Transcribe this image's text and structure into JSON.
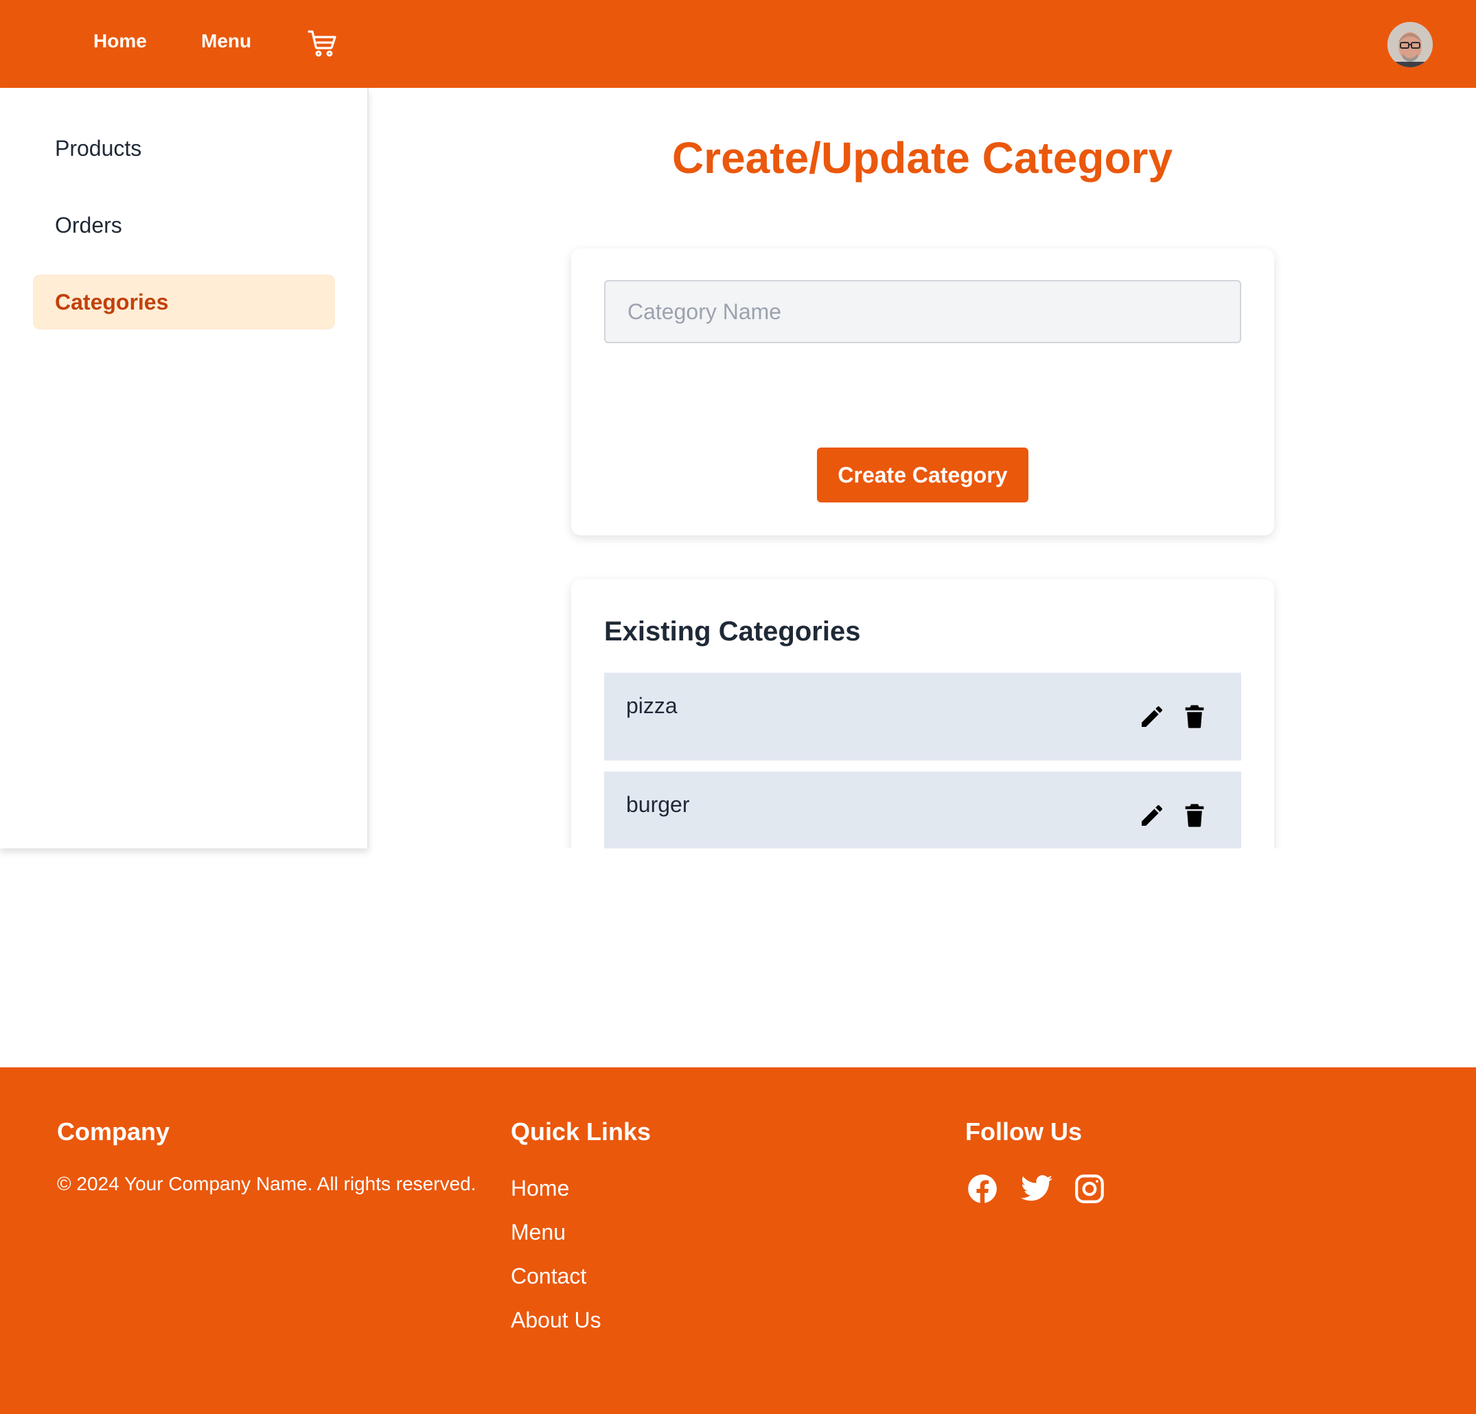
{
  "header": {
    "nav": [
      {
        "label": "Home"
      },
      {
        "label": "Menu"
      }
    ],
    "cart_icon": "shopping-cart-icon",
    "avatar": "user-avatar"
  },
  "sidebar": {
    "items": [
      {
        "label": "Products",
        "active": false
      },
      {
        "label": "Orders",
        "active": false
      },
      {
        "label": "Categories",
        "active": true
      }
    ]
  },
  "main": {
    "title": "Create/Update Category",
    "form": {
      "category_name": {
        "value": "",
        "placeholder": "Category Name"
      },
      "submit_label": "Create Category"
    },
    "list": {
      "heading": "Existing Categories",
      "items": [
        {
          "name": "pizza",
          "actions": [
            "pencil-icon",
            "trash-icon"
          ]
        },
        {
          "name": "burger",
          "actions": [
            "pencil-icon",
            "trash-icon"
          ]
        }
      ]
    }
  },
  "footer": {
    "company": {
      "heading": "Company",
      "copyright": "© 2024 Your Company Name. All rights reserved."
    },
    "quick_links": {
      "heading": "Quick Links",
      "links": [
        {
          "label": "Home"
        },
        {
          "label": "Menu"
        },
        {
          "label": "Contact"
        },
        {
          "label": "About Us"
        }
      ]
    },
    "follow": {
      "heading": "Follow Us",
      "icons": [
        "facebook-icon",
        "twitter-icon",
        "instagram-icon"
      ]
    }
  },
  "colors": {
    "brand": "#ea580c",
    "active_bg": "#ffedd5",
    "active_text": "#c2410c",
    "row_bg": "#e2e8f0"
  }
}
